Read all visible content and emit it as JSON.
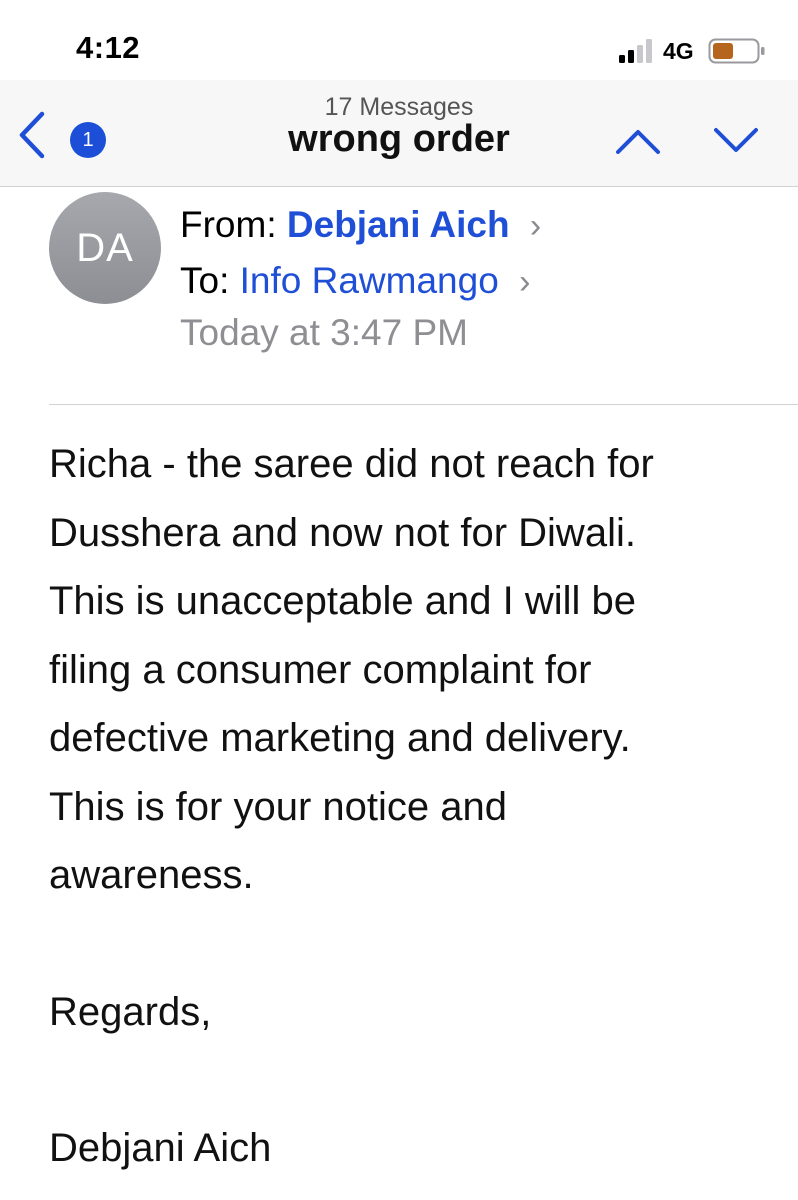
{
  "status_bar": {
    "time": "4:12",
    "network": "4G",
    "icons": [
      "signal-icon",
      "battery-icon"
    ]
  },
  "nav": {
    "message_count": "17 Messages",
    "title": "wrong order",
    "unread_count": "1",
    "icons": [
      "chevron-left-icon",
      "chevron-up-icon",
      "chevron-down-icon"
    ]
  },
  "mail": {
    "avatar_initials": "DA",
    "from_label": "From:",
    "from_name": "Debjani Aich",
    "to_label": "To:",
    "to_name": "Info Rawmango",
    "date": "Today at 3:47 PM",
    "body": [
      "Richa - the saree did not reach for",
      "Dusshera and now not for Diwali.",
      "This is unacceptable and I will be",
      "filing a consumer complaint for",
      "defective marketing and delivery.",
      "This is for your notice and",
      "awareness."
    ],
    "closing": "Regards,",
    "signature": "Debjani Aich"
  },
  "colors": {
    "accent": "#1f4fd6",
    "badge": "#1c4ed8",
    "secondary_text": "#8e8e93",
    "battery_fill": "#b5651d"
  }
}
